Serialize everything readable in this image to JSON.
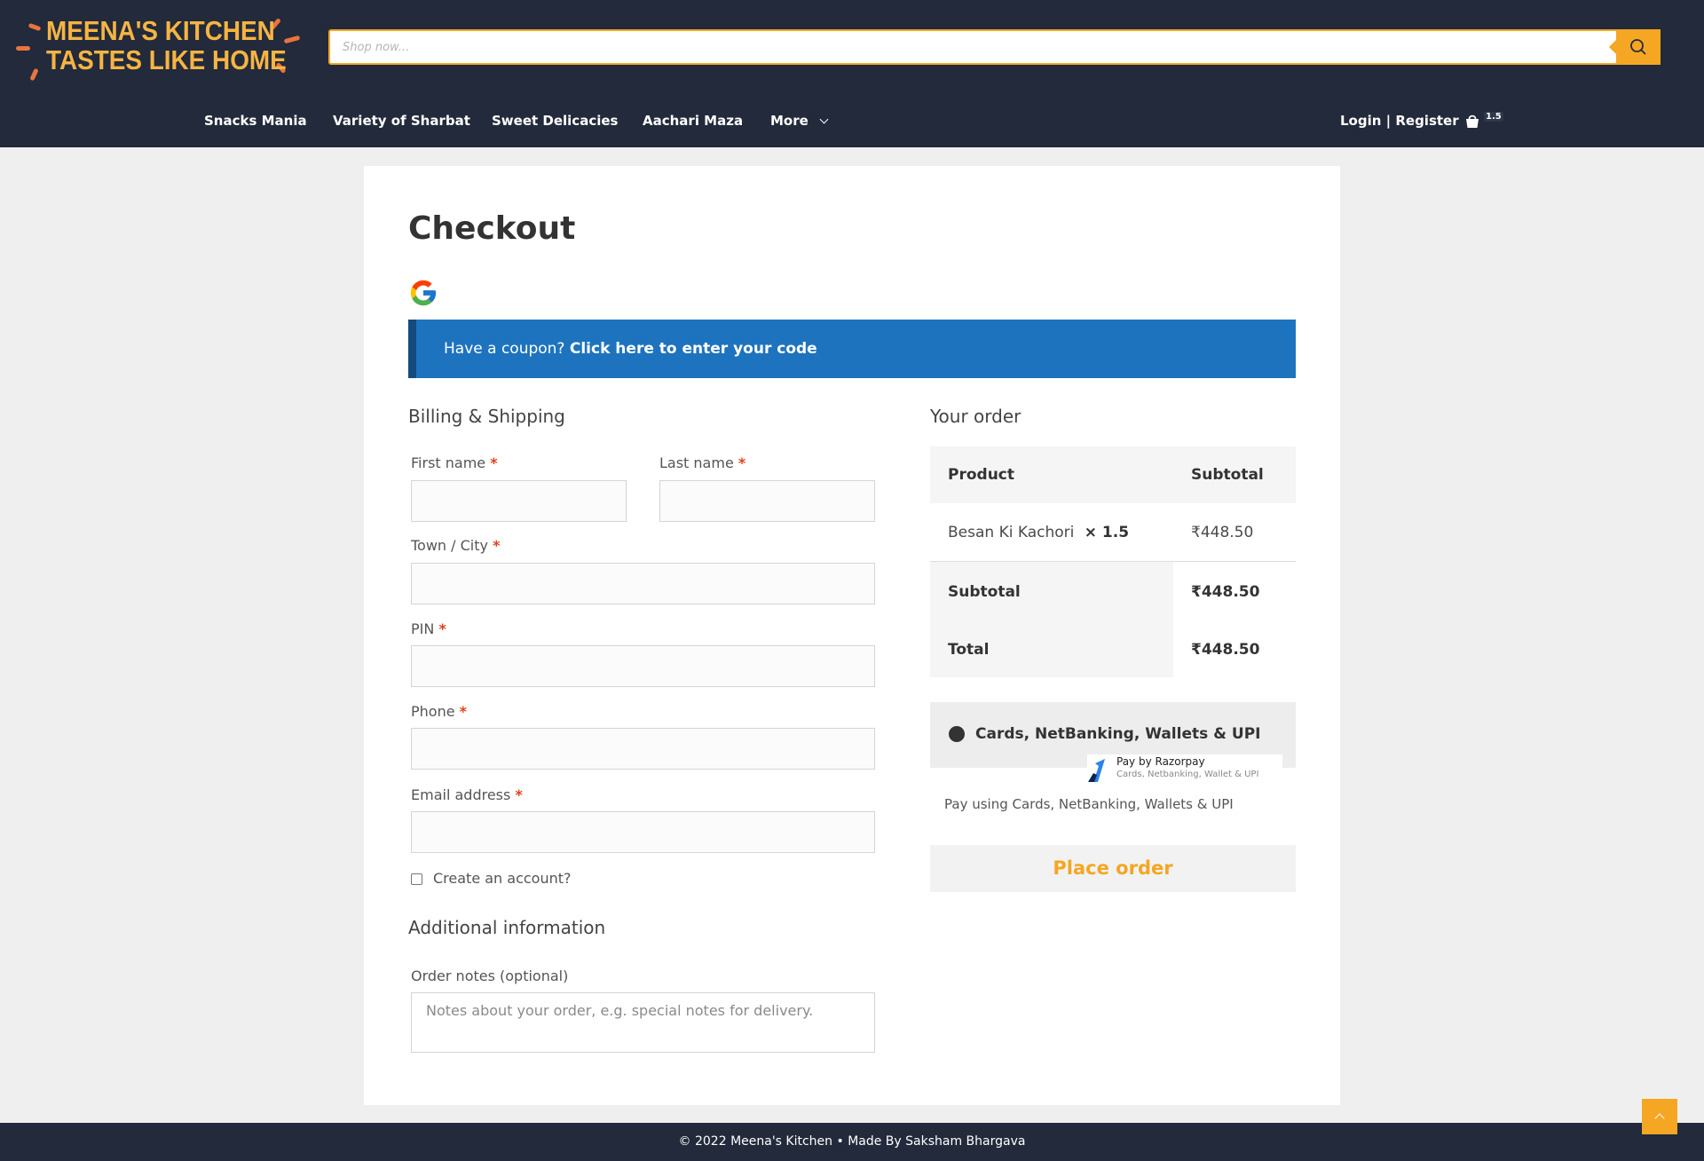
{
  "brand": {
    "line1": "MEENA'S KITCHEN",
    "line2": "TASTES LIKE HOME",
    "accent": "#f5a623",
    "header_bg": "#222a3b"
  },
  "search": {
    "placeholder": "Shop now..."
  },
  "nav": {
    "items": [
      "Snacks Mania",
      "Variety of Sharbat",
      "Sweet Delicacies",
      "Aachari Maza",
      "More"
    ],
    "login": "Login | Register",
    "cart_count": "1.5"
  },
  "checkout": {
    "title": "Checkout",
    "coupon": {
      "text": "Have a coupon?",
      "link": "Click here to enter your code"
    },
    "billing": {
      "title": "Billing & Shipping",
      "first_name": "First name",
      "last_name": "Last name",
      "city": "Town / City",
      "pin": "PIN",
      "phone": "Phone",
      "email": "Email address",
      "required_mark": "*",
      "create_account": "Create an account?"
    },
    "additional": {
      "title": "Additional information",
      "notes_label": "Order notes (optional)",
      "notes_placeholder": "Notes about your order, e.g. special notes for delivery."
    },
    "order": {
      "title": "Your order",
      "col_product": "Product",
      "col_subtotal": "Subtotal",
      "item_name": "Besan Ki Kachori",
      "item_qty": "× 1.5",
      "item_price": "₹448.50",
      "subtotal_label": "Subtotal",
      "subtotal_value": "₹448.50",
      "total_label": "Total",
      "total_value": "₹448.50"
    },
    "payment": {
      "method": "Cards, NetBanking, Wallets & UPI",
      "brand_line1": "Pay by Razorpay",
      "brand_line2": "Cards, Netbanking, Wallet & UPI",
      "description": "Pay using Cards, NetBanking, Wallets & UPI",
      "place_order": "Place order"
    }
  },
  "footer": {
    "text": "© 2022 Meena's Kitchen • Made By Saksham Bhargava"
  }
}
